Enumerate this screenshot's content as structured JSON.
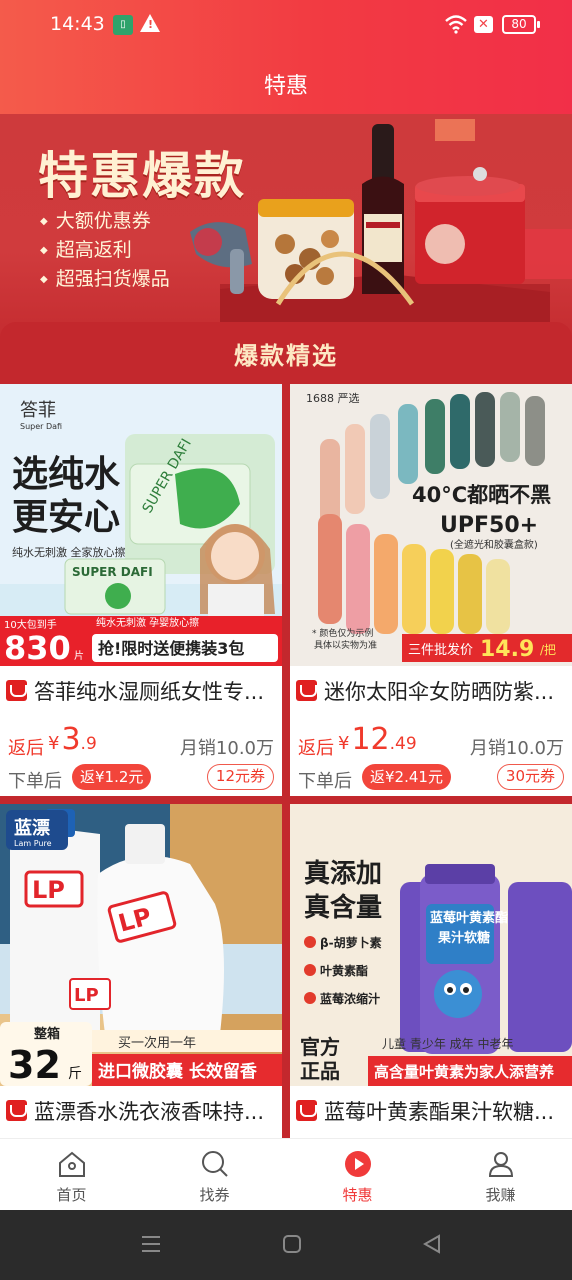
{
  "status": {
    "time": "14:43",
    "battery": "80"
  },
  "header": {
    "title": "特惠"
  },
  "banner": {
    "title": "特惠爆款",
    "perks": [
      "大额优惠券",
      "超高返利",
      "超强扫货爆品"
    ]
  },
  "section": {
    "title": "爆款精选"
  },
  "products": [
    {
      "name": "答菲纯水湿厕纸女性专...",
      "rebate_label": "返后",
      "price_int": "3",
      "price_dec": ".9",
      "sales": "月销10.0万",
      "buy_label": "下单后",
      "back": "返¥1.2元",
      "coupon": "12元券",
      "img": {
        "brand": "答菲",
        "brand_en": "Super Dafi",
        "headline1": "选纯水",
        "headline2": "更安心",
        "sub": "纯水无刺激 全家放心擦",
        "pack": "10大包到手",
        "price": "830",
        "unit": "片",
        "promo": "抢!限时送便携装3包",
        "promo2": "纯水无刺激 孕婴放心擦"
      }
    },
    {
      "name": "迷你太阳伞女防晒防紫...",
      "rebate_label": "返后",
      "price_int": "12",
      "price_dec": ".49",
      "sales": "月销10.0万",
      "buy_label": "下单后",
      "back": "返¥2.41元",
      "coupon": "30元券",
      "img": {
        "brand": "1688 严选",
        "headline1": "40°C都晒不黑",
        "headline2": "UPF50+",
        "sub": "(全遮光和胶囊盒款)",
        "note1": "* 颜色仅为示例",
        "note2": "具体以实物为准",
        "promo_label": "三件批发价",
        "promo_price": "14.9",
        "promo_unit": "/把"
      }
    },
    {
      "name": "蓝漂香水洗衣液香味持...",
      "img": {
        "brand": "蓝漂",
        "brand_en": "Lam Pure",
        "logo": "LP",
        "box": "整箱",
        "qty": "32",
        "unit": "斤",
        "promo_top": "买一次用一年",
        "promo": "进口微胶囊 长效留香"
      }
    },
    {
      "name": "蓝莓叶黄素酯果汁软糖...",
      "img": {
        "headline1": "真添加",
        "headline2": "真含量",
        "points": [
          "β-胡萝卜素",
          "叶黄素酯",
          "蓝莓浓缩汁"
        ],
        "jar_title": "蓝莓叶黄素酯",
        "jar_sub": "果汁软糖",
        "badge1": "官方",
        "badge2": "正品",
        "audience": "儿童 青少年 成年 中老年",
        "promo": "高含量叶黄素为家人添营养"
      }
    }
  ],
  "tabs": [
    {
      "label": "首页",
      "icon": "home-icon"
    },
    {
      "label": "找券",
      "icon": "search-icon"
    },
    {
      "label": "特惠",
      "icon": "play-icon"
    },
    {
      "label": "我赚",
      "icon": "user-icon"
    }
  ],
  "colors": {
    "accent": "#f03a3a",
    "section_bg": "#c3282d",
    "header": "#f23b42"
  }
}
